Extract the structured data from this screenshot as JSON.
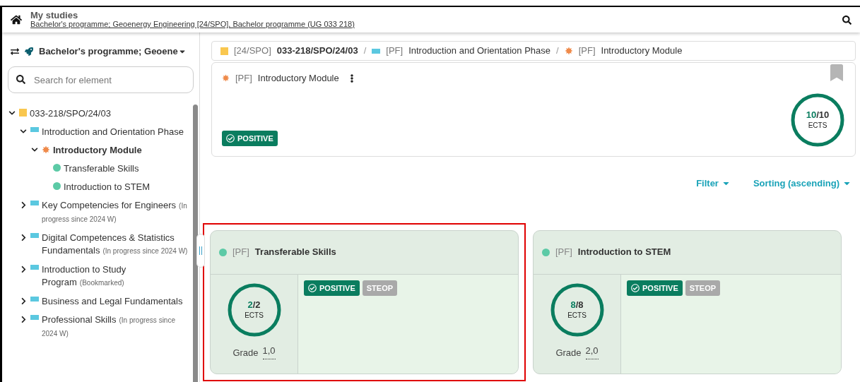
{
  "header": {
    "title": "My studies",
    "subtitle": "Bachelor's programme; Geoenergy Engineering [24/SPO], Bachelor programme (UG 033 218)"
  },
  "sidebar": {
    "programme": "Bachelor's programme; Geoene",
    "search": {
      "placeholder": "Search for element"
    },
    "tree": [
      {
        "kind": "folder",
        "label": "033-218/SPO/24/03",
        "expanded": true,
        "selected": false,
        "children": [
          {
            "kind": "category",
            "label": "Introduction and Orientation Phase",
            "expanded": true,
            "selected": false,
            "children": [
              {
                "kind": "module",
                "label": "Introductory Module",
                "expanded": true,
                "selected": true,
                "children": [
                  {
                    "kind": "leaf",
                    "label": "Transferable Skills",
                    "selected": false
                  },
                  {
                    "kind": "leaf",
                    "label": "Introduction to STEM",
                    "selected": false
                  }
                ]
              }
            ]
          },
          {
            "kind": "category",
            "label": "Key Competencies for Engineers",
            "note": "(In progress since 2024 W)",
            "expanded": false,
            "selected": false
          },
          {
            "kind": "category",
            "label": "Digital Competences & Statistics Fundamentals",
            "note": "(In progress since 2024 W)",
            "expanded": false,
            "selected": false
          },
          {
            "kind": "category",
            "label": "Introduction to Study Program",
            "note": "(Bookmarked)",
            "expanded": false,
            "selected": false
          },
          {
            "kind": "category",
            "label": "Business and Legal Fundamentals",
            "expanded": false,
            "selected": false
          },
          {
            "kind": "category",
            "label": "Professional Skills",
            "note": "(In progress since 2024 W)",
            "expanded": false,
            "selected": false
          }
        ]
      }
    ]
  },
  "breadcrumb": [
    {
      "kind": "folder",
      "prefix": "[24/SPO]",
      "label": "033-218/SPO/24/03"
    },
    {
      "kind": "category",
      "separator": "/",
      "prefix": "[PF]",
      "label": "Introduction and Orientation Phase"
    },
    {
      "kind": "module",
      "separator": "/",
      "prefix": "[PF]",
      "label": "Introductory Module"
    }
  ],
  "module": {
    "prefix": "[PF]",
    "title": "Introductory Module",
    "badge": "POSITIVE",
    "earned": "10",
    "total": "/10",
    "unit": "ECTS"
  },
  "controls": {
    "filter": "Filter",
    "sorting": "Sorting (ascending)"
  },
  "cards": [
    {
      "color": "#5ccaa6",
      "prefix": "[PF]",
      "title": "Transferable Skills",
      "earned": "2",
      "total": "/2",
      "unit": "ECTS",
      "grade_label": "Grade",
      "grade": "1,0",
      "highlighted": true,
      "badges": [
        {
          "kind": "status",
          "label": "POSITIVE"
        },
        {
          "kind": "tag",
          "label": "STEOP"
        }
      ]
    },
    {
      "color": "#5ccaa6",
      "prefix": "[PF]",
      "title": "Introduction to STEM",
      "earned": "8",
      "total": "/8",
      "unit": "ECTS",
      "grade_label": "Grade",
      "grade": "2,0",
      "highlighted": false,
      "badges": [
        {
          "kind": "status",
          "label": "POSITIVE"
        },
        {
          "kind": "tag",
          "label": "STEOP"
        }
      ]
    }
  ]
}
